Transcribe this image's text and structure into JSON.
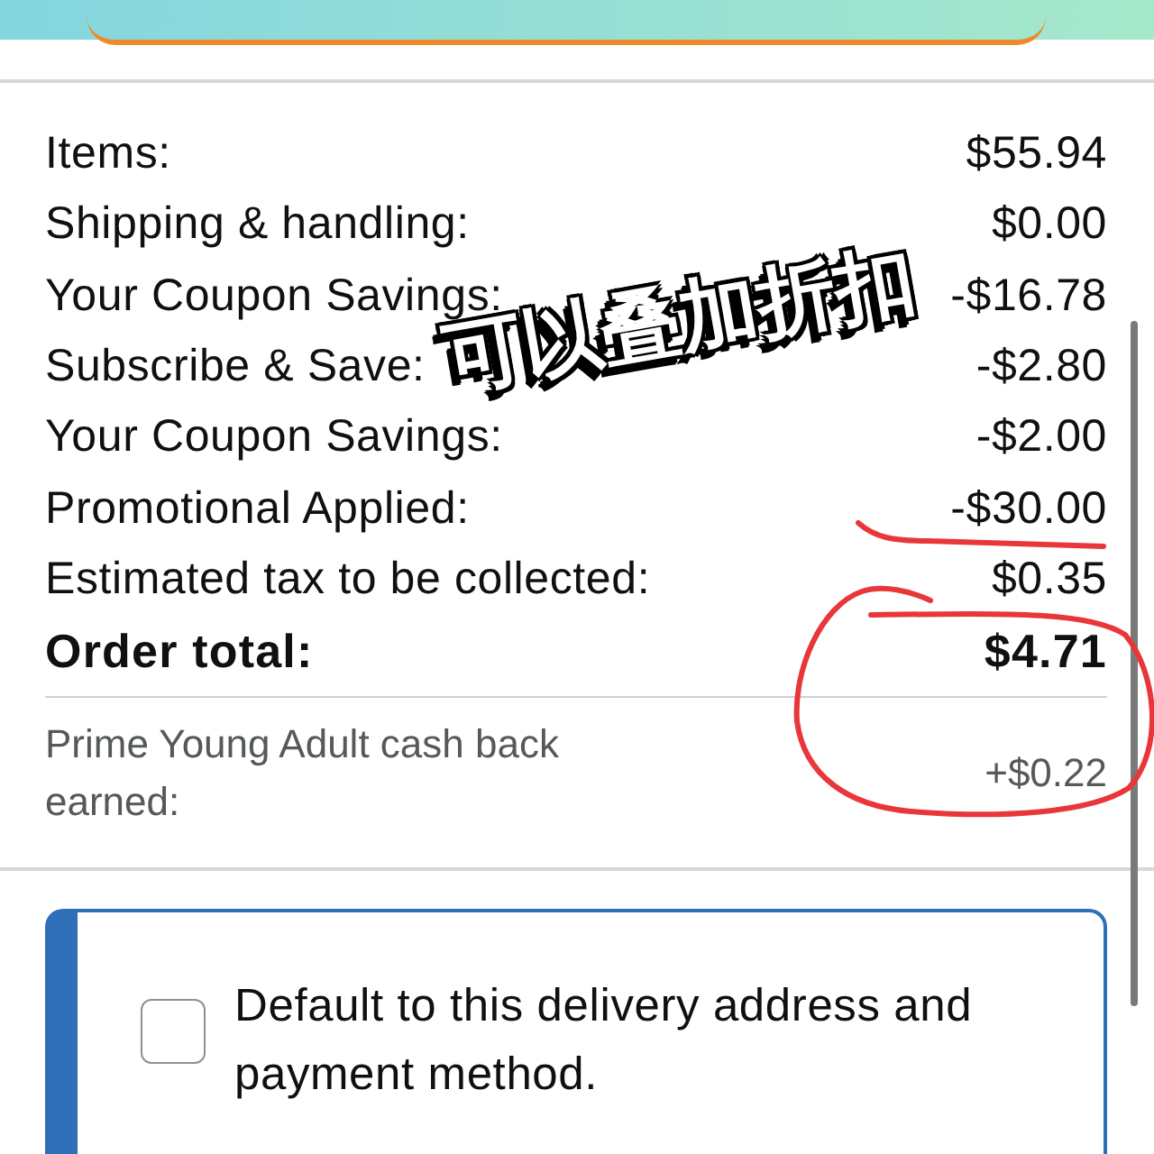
{
  "summary": {
    "rows": [
      {
        "label": "Items:",
        "value": "$55.94"
      },
      {
        "label": "Shipping & handling:",
        "value": "$0.00"
      },
      {
        "label": "Your Coupon Savings:",
        "value": "-$16.78"
      },
      {
        "label": "Subscribe & Save:",
        "value": "-$2.80"
      },
      {
        "label": "Your Coupon Savings:",
        "value": "-$2.00"
      },
      {
        "label": "Promotional Applied:",
        "value": "-$30.00"
      },
      {
        "label": "Estimated tax to be collected:",
        "value": "$0.35"
      }
    ],
    "total": {
      "label": "Order total:",
      "value": "$4.71"
    }
  },
  "cashback": {
    "label": "Prime Young Adult cash back earned:",
    "value": "+$0.22"
  },
  "default_option": {
    "label": "Default to this delivery address and payment method.",
    "checked": false
  },
  "annotations": [
    {
      "kind": "sticker",
      "text": "可以叠加折扣"
    },
    {
      "kind": "underline"
    },
    {
      "kind": "circle"
    }
  ]
}
